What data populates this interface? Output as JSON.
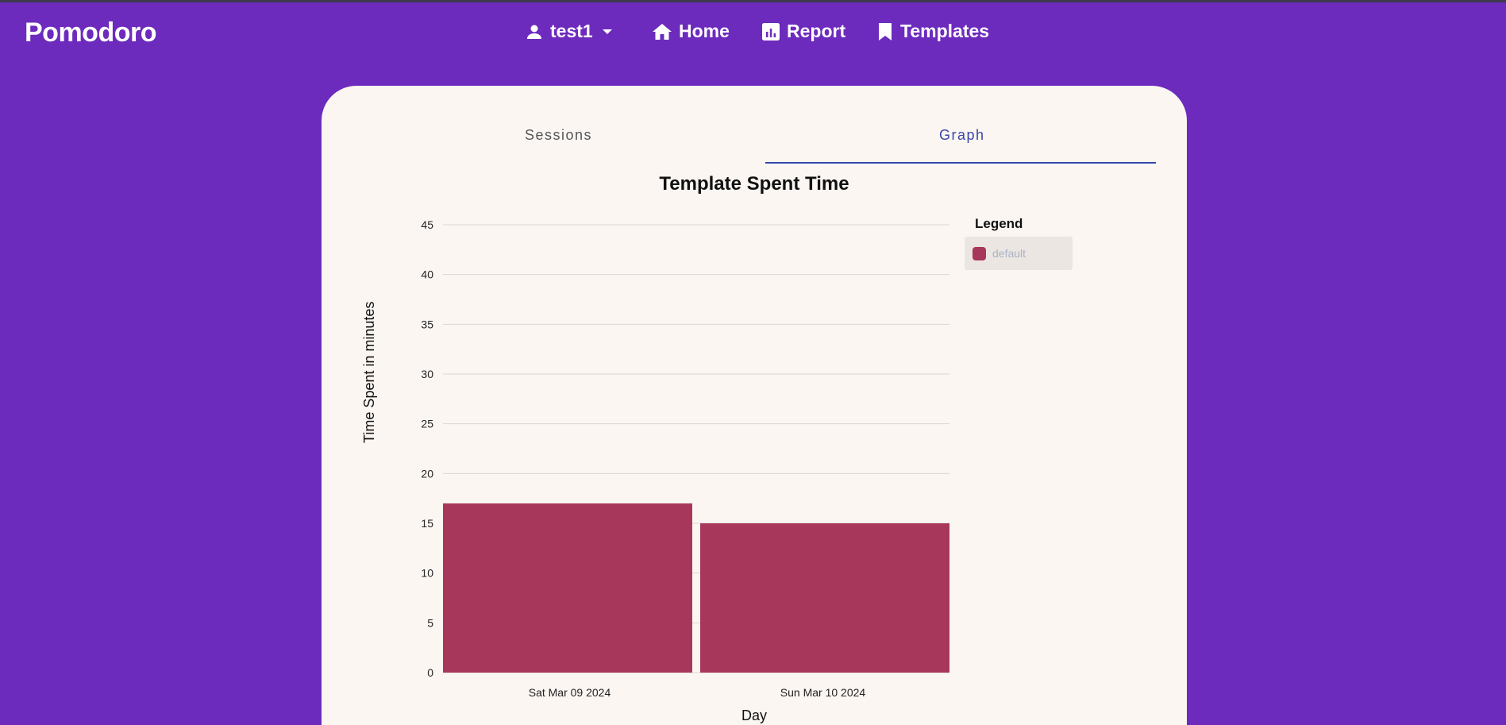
{
  "app": {
    "title": "Pomodoro"
  },
  "nav": {
    "user": "test1",
    "home": "Home",
    "report": "Report",
    "templates": "Templates"
  },
  "tabs": [
    {
      "label": "Sessions",
      "active": false
    },
    {
      "label": "Graph",
      "active": true
    }
  ],
  "colors": {
    "background": "#6d2bbd",
    "card": "#fbf6f2",
    "bar": "#a8375c",
    "tab_active": "#3b46a6"
  },
  "chart_data": {
    "type": "bar",
    "title": "Template Spent Time",
    "xlabel": "Day",
    "ylabel": "Time Spent in minutes",
    "categories": [
      "Sat Mar 09 2024",
      "Sun Mar 10 2024"
    ],
    "series": [
      {
        "name": "default",
        "values": [
          17,
          15
        ],
        "color": "#a8375c"
      }
    ],
    "ylim": [
      0,
      45
    ],
    "yticks": [
      0,
      5,
      10,
      15,
      20,
      25,
      30,
      35,
      40,
      45
    ],
    "grid": true,
    "legend": {
      "title": "Legend",
      "position": "right"
    }
  }
}
